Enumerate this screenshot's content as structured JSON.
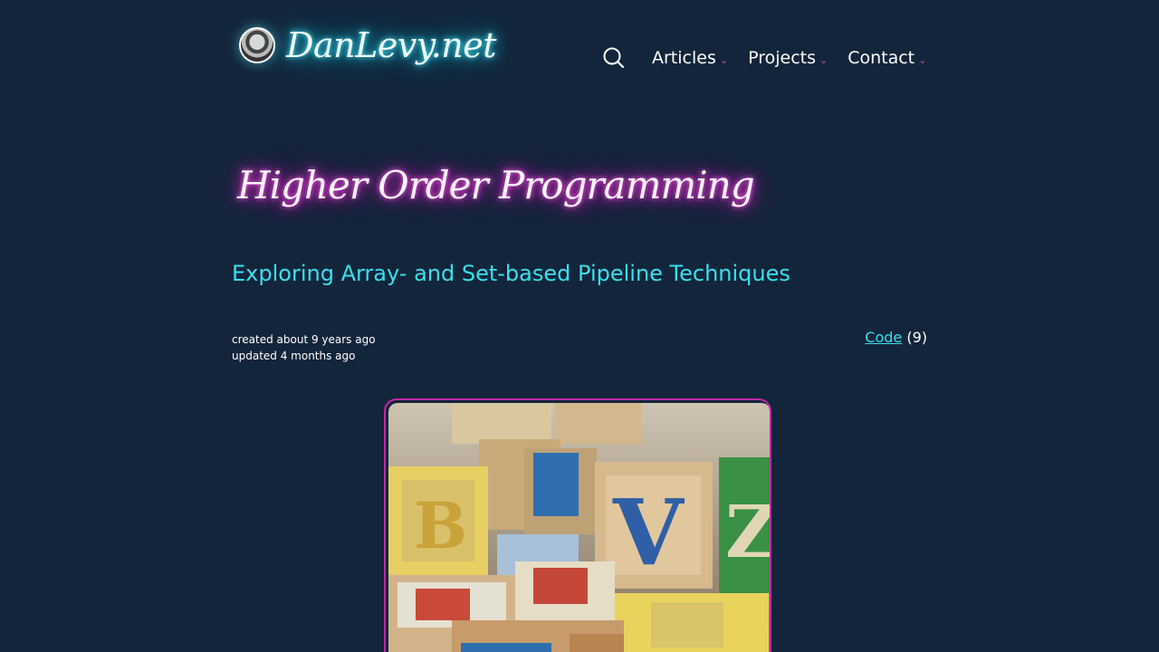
{
  "site": {
    "name": "DanLevy.net"
  },
  "nav": {
    "items": [
      {
        "label": "Articles"
      },
      {
        "label": "Projects"
      },
      {
        "label": "Contact"
      }
    ]
  },
  "article": {
    "title": "Higher Order Programming",
    "subtitle": "Exploring Array- and Set-based Pipeline Techniques",
    "created": "created about 9 years ago",
    "updated": "updated 4 months ago",
    "category_label": "Code",
    "category_count": "(9)"
  },
  "colors": {
    "background": "#13253a",
    "accent_cyan": "#37e0ee",
    "accent_magenta": "#e020c8"
  },
  "icons": {
    "search": "search-icon",
    "chevron": "chevron-down-icon"
  }
}
